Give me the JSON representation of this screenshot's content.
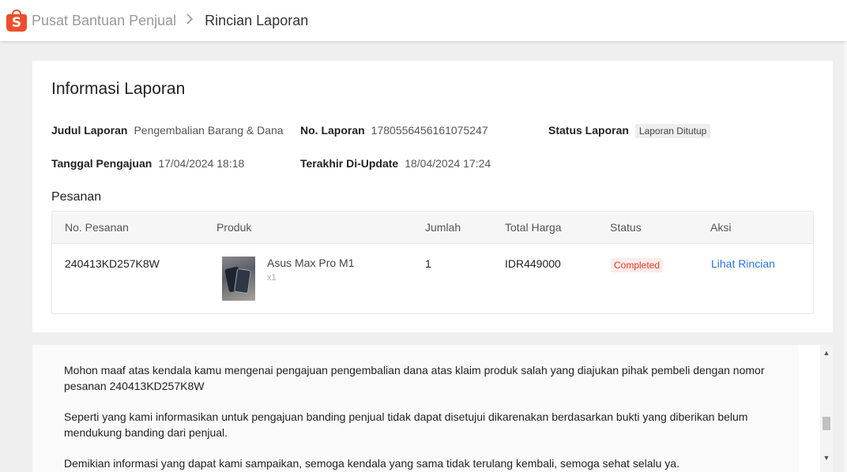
{
  "colors": {
    "brand": "#ee4d2d",
    "link": "#2673dd",
    "status_completed": "#e03a24"
  },
  "breadcrumb": {
    "logo_icon": "shopee-bag-icon",
    "home": "Pusat Bantuan Penjual",
    "separator_icon": "chevron-right-icon",
    "current": "Rincian Laporan"
  },
  "report": {
    "title": "Informasi Laporan",
    "fields": {
      "judul_label": "Judul Laporan",
      "judul_value": "Pengembalian Barang & Dana",
      "no_label": "No. Laporan",
      "no_value": "1780556456161075247",
      "status_label": "Status Laporan",
      "status_value": "Laporan Ditutup",
      "tanggal_label": "Tanggal Pengajuan",
      "tanggal_value": "17/04/2024 18:18",
      "update_label": "Terakhir Di-Update",
      "update_value": "18/04/2024 17:24"
    },
    "orders_title": "Pesanan",
    "table": {
      "headers": [
        "No. Pesanan",
        "Produk",
        "Jumlah",
        "Total Harga",
        "Status",
        "Aksi"
      ],
      "rows": [
        {
          "order_no": "240413KD257K8W",
          "product_name": "Asus Max Pro M1",
          "product_qty": "x1",
          "jumlah": "1",
          "total": "IDR449000",
          "status": "Completed",
          "action": "Lihat Rincian"
        }
      ]
    }
  },
  "message": {
    "p1": "Mohon maaf atas kendala kamu mengenai pengajuan pengembalian dana atas klaim produk salah yang diajukan pihak pembeli dengan nomor pesanan  240413KD257K8W",
    "p2": "Seperti yang kami informasikan untuk pengajuan banding penjual tidak dapat disetujui dikarenakan berdasarkan bukti yang diberikan belum mendukung banding dari penjual.",
    "p3": "Demikian informasi yang dapat kami sampaikan, semoga kendala yang sama tidak terulang kembali, semoga sehat selalu ya."
  },
  "scrollbar": {
    "up_icon": "arrow-up-icon",
    "down_icon": "arrow-down-icon"
  }
}
